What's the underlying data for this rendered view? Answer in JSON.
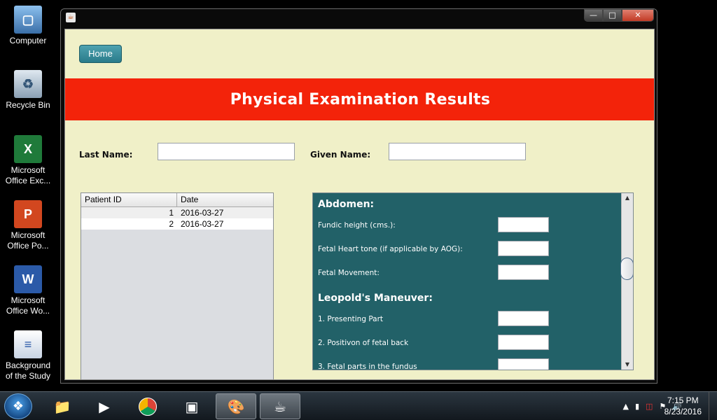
{
  "desktop": {
    "icons": [
      {
        "label": "Computer"
      },
      {
        "label": "Recycle Bin"
      },
      {
        "label": "Microsoft Office Exc..."
      },
      {
        "label": "Microsoft Office Po..."
      },
      {
        "label": "Microsoft Office Wo..."
      },
      {
        "label": "Background of the Study"
      }
    ]
  },
  "window": {
    "controls": {
      "minimize": "—",
      "maximize": "□",
      "close": "✕"
    }
  },
  "page": {
    "home_label": "Home",
    "title": "Physical Examination Results",
    "last_name_label": "Last Name:",
    "last_name_value": "",
    "given_name_label": "Given Name:",
    "given_name_value": ""
  },
  "table": {
    "columns": [
      "Patient ID",
      "Date"
    ],
    "rows": [
      {
        "id": "1",
        "date": "2016-03-27"
      },
      {
        "id": "2",
        "date": "2016-03-27"
      }
    ]
  },
  "exam": {
    "abdomen_title": "Abdomen:",
    "fields": [
      {
        "label": "Fundic height (cms.):",
        "value": ""
      },
      {
        "label": "Fetal Heart tone (if applicable by AOG):",
        "value": ""
      },
      {
        "label": "Fetal Movement:",
        "value": ""
      }
    ],
    "leopold_title": "Leopold's Maneuver:",
    "leopold_fields": [
      {
        "label": "1. Presenting Part",
        "value": ""
      },
      {
        "label": "2. Positivon of fetal back",
        "value": ""
      },
      {
        "label": "3. Fetal parts in the fundus",
        "value": ""
      }
    ]
  },
  "taskbar": {
    "clock_time": "7:15 PM",
    "clock_date": "8/23/2016",
    "apps": [
      "file-explorer-icon",
      "media-player-icon",
      "chrome-icon",
      "virtualbox-icon",
      "paint-icon",
      "java-icon"
    ]
  },
  "colors": {
    "banner": "#f3230a",
    "panel": "#226168",
    "client_bg": "#f0f0c8",
    "home_button": "#2a7b8a"
  }
}
